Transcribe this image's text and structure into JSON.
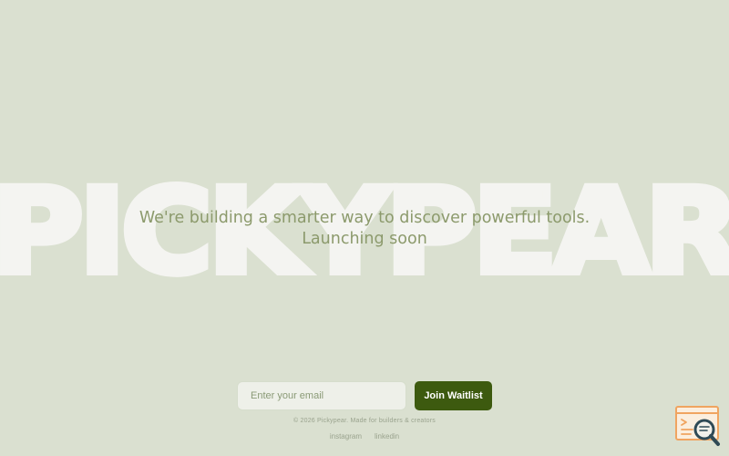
{
  "brand": {
    "wordmark": "PICKYPEAR"
  },
  "hero": {
    "tagline_line1": "We're building a smarter way to discover powerful tools.",
    "tagline_line2": "Launching soon"
  },
  "waitlist": {
    "email_placeholder": "Enter your email",
    "email_value": "",
    "join_label": "Join Waitlist"
  },
  "footer": {
    "copyright": "© 2026 Pickypear. Made for builders & creators",
    "links": [
      {
        "label": "instagram"
      },
      {
        "label": "linkedin"
      }
    ]
  },
  "widget": {
    "icon": "search-chat-icon"
  },
  "colors": {
    "background": "#dae0d0",
    "wordmark": "#f4f4f1",
    "tagline": "#8c9a6c",
    "button_bg": "#3d5a0f",
    "button_text": "#ffffff",
    "input_bg": "#eef0e9",
    "input_placeholder": "#8a9a76",
    "footer_text": "#9aa38e",
    "widget_orange": "#f0a460",
    "widget_dark": "#2f4a55"
  }
}
